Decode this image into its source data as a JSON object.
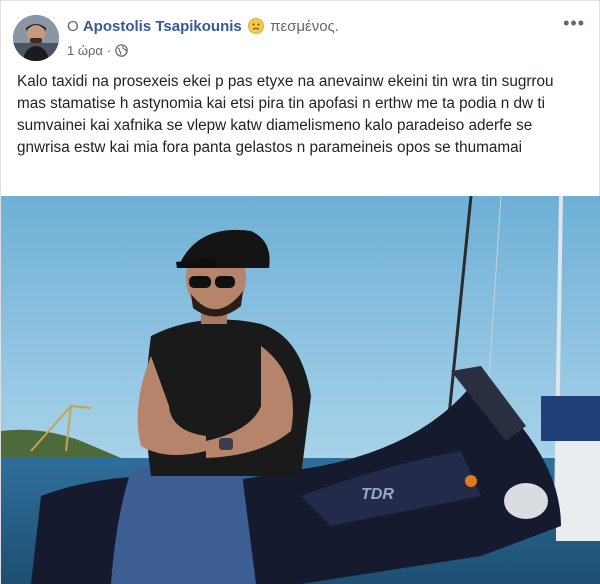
{
  "post": {
    "prefix": "Ο",
    "author": "Apostolis Tsapikounis",
    "feeling_icon": "sad-face-icon",
    "feeling": "πεσμένος.",
    "time": "1 ώρα",
    "separator": "·",
    "privacy_icon": "globe-icon",
    "options_icon": "more-options-icon",
    "text": "Kalo taxidi na prosexeis ekei p pas etyxe na anevainw ekeini tin wra tin sugrrou mas stamatise h astynomia kai etsi pira tin apofasi n erthw me ta podia n dw ti sumvainei kai xafnika se vlepw katw diamelismeno kalo paradeiso aderfe se gnwrisa estw kai mia fora panta gelastos n parameineis opos se thumamai",
    "photo_text": "TDR"
  },
  "colors": {
    "author": "#385898",
    "meta": "#606770",
    "text": "#1d2129"
  }
}
